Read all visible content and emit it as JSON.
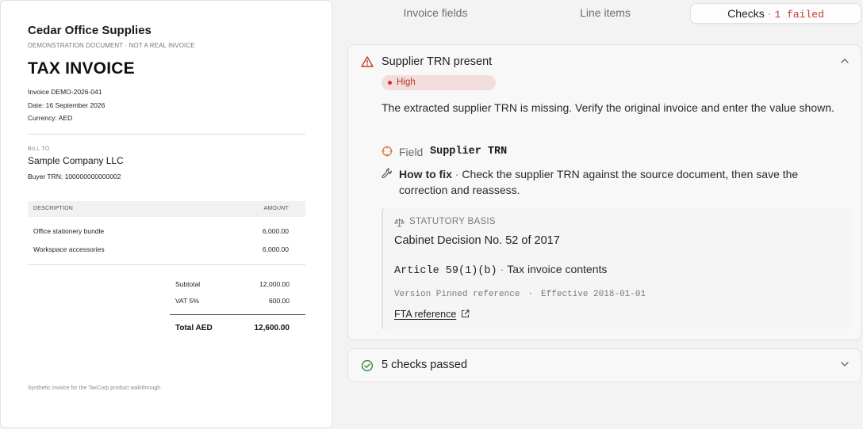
{
  "invoice": {
    "company": "Cedar Office Supplies",
    "demo_note": "DEMONSTRATION DOCUMENT · NOT A REAL INVOICE",
    "title": "TAX INVOICE",
    "invoice_no": "Invoice DEMO-2026-041",
    "date": "Date: 16 September 2026",
    "currency": "Currency: AED",
    "bill_to_label": "BILL TO",
    "bill_to_name": "Sample Company LLC",
    "buyer_trn": "Buyer TRN: 100000000000002",
    "columns": {
      "description": "DESCRIPTION",
      "amount": "AMOUNT"
    },
    "lines": [
      {
        "description": "Office stationery bundle",
        "amount": "6,000.00"
      },
      {
        "description": "Workspace accessories",
        "amount": "6,000.00"
      }
    ],
    "subtotal_label": "Subtotal",
    "subtotal": "12,000.00",
    "vat_label": "VAT 5%",
    "vat": "600.00",
    "total_label": "Total AED",
    "total": "12,600.00",
    "footnote": "Synthetic invoice for the TaxCorp product walkthrough."
  },
  "tabs": {
    "invoice_fields": "Invoice fields",
    "line_items": "Line items",
    "checks": "Checks",
    "checks_sep": "·",
    "checks_failed": "1 failed"
  },
  "check": {
    "title": "Supplier TRN present",
    "severity": "High",
    "description": "The extracted supplier TRN is missing. Verify the original invoice and enter the value shown.",
    "field_label": "Field",
    "field_value": "Supplier TRN",
    "how_to_fix_label": "How to fix",
    "how_to_fix_sep": "·",
    "how_to_fix_text": "Check the supplier TRN against the source document, then save the correction and reassess.",
    "basis": {
      "label": "STATUTORY BASIS",
      "decision": "Cabinet Decision No. 52 of 2017",
      "article_code": "Article 59(1)(b)",
      "article_sep": "·",
      "article_title": "Tax invoice contents",
      "version": "Version Pinned reference",
      "version_sep": "·",
      "effective": "Effective 2018-01-01",
      "link": "FTA reference"
    }
  },
  "passed": {
    "label": "5 checks passed"
  },
  "colors": {
    "danger": "#c23a2a",
    "success": "#2e8b3d",
    "severity_bg": "#f3dddc"
  },
  "icons": {
    "warning": "warning-triangle-icon",
    "field": "target-icon",
    "fix": "wrench-icon",
    "basis": "scales-icon",
    "external": "external-link-icon",
    "passed": "check-circle-icon",
    "collapse": "chevron-up-icon",
    "expand": "chevron-down-icon"
  }
}
